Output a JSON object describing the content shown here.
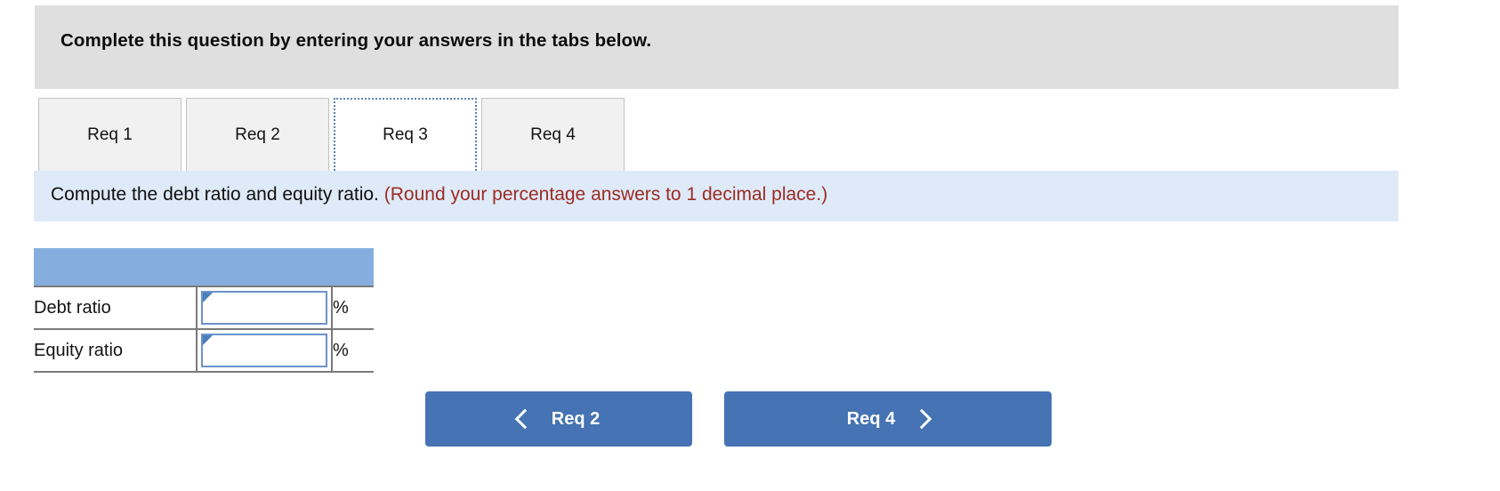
{
  "banner": {
    "instruction": "Complete this question by entering your answers in the tabs below."
  },
  "tabs": [
    {
      "label": "Req 1",
      "active": false
    },
    {
      "label": "Req 2",
      "active": false
    },
    {
      "label": "Req 3",
      "active": true
    },
    {
      "label": "Req 4",
      "active": false
    }
  ],
  "requirement": {
    "prompt": "Compute the debt ratio and equity ratio.",
    "rounding_note": "(Round your percentage answers to 1 decimal place.)"
  },
  "answer_table": {
    "header_blank": "",
    "rows": [
      {
        "label": "Debt ratio",
        "value": "",
        "placeholder": "",
        "unit": "%"
      },
      {
        "label": "Equity ratio",
        "value": "",
        "placeholder": "",
        "unit": "%"
      }
    ]
  },
  "navigation": {
    "prev_label": "Req 2",
    "next_label": "Req 4"
  },
  "colors": {
    "banner_gray": "#dfdfdf",
    "requirement_blue": "#deeaf7",
    "table_header_blue": "#85aede",
    "button_blue": "#4573b3",
    "note_red": "#9c2b23",
    "input_border_blue": "#6b93c9",
    "input_flag_blue": "#4a7ebb"
  }
}
